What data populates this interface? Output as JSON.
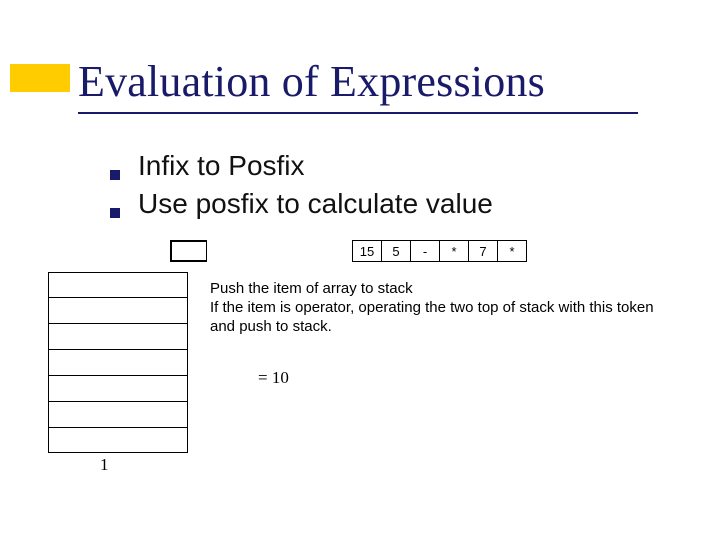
{
  "title": "Evaluation of Expressions",
  "bullets": [
    "Infix to Posfix",
    "Use  posfix to calculate value"
  ],
  "tokens": [
    "",
    "",
    "",
    "",
    "",
    "",
    "15",
    "5",
    "-",
    "*",
    "7",
    "*"
  ],
  "desc_line1": "Push the item of array to stack",
  "desc_line2": "If the item is operator, operating the two top of stack with this token and push to stack.",
  "result": "= 10",
  "stack_label": "1"
}
